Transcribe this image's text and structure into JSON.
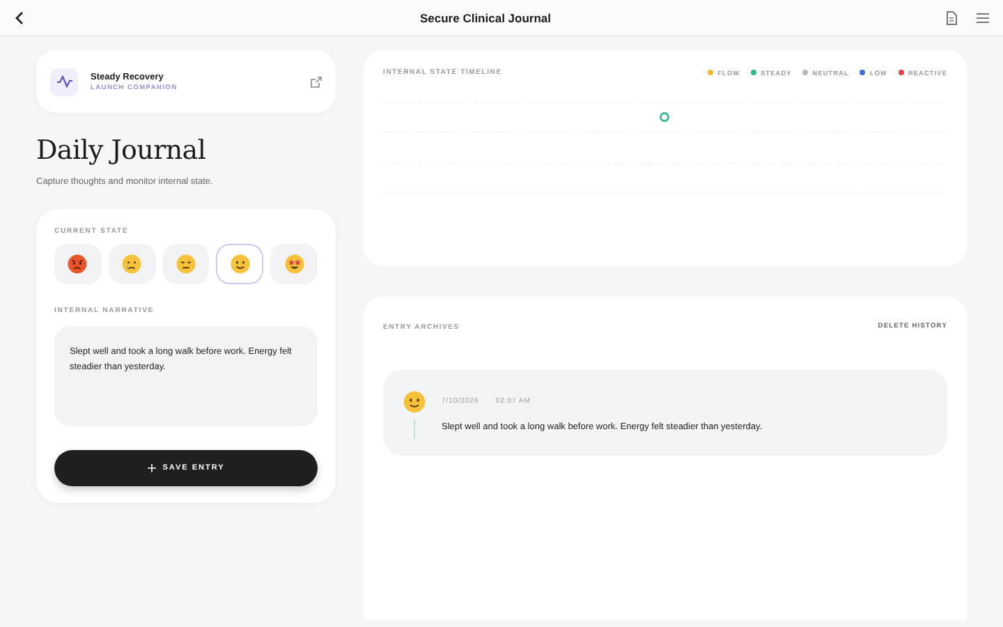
{
  "topbar": {
    "title": "Secure Clinical Journal"
  },
  "companion": {
    "title": "Steady Recovery",
    "subtitle": "LAUNCH COMPANION"
  },
  "heading": "Daily Journal",
  "subheading": "Capture thoughts and monitor internal state.",
  "form": {
    "state_label": "CURRENT STATE",
    "moods": [
      {
        "kind": "angry",
        "selected": false
      },
      {
        "kind": "crying",
        "selected": false
      },
      {
        "kind": "flat",
        "selected": false
      },
      {
        "kind": "smile",
        "selected": true
      },
      {
        "kind": "starstruck",
        "selected": false
      }
    ],
    "narrative_label": "INTERNAL NARRATIVE",
    "narrative": "Slept well and took a long walk before work. Energy felt steadier than yesterday.",
    "save": "SAVE ENTRY"
  },
  "timeline": {
    "title": "INTERNAL STATE TIMELINE",
    "legend": [
      {
        "label": "FLOW",
        "color": "#f5b82e"
      },
      {
        "label": "STEADY",
        "color": "#2ebd85"
      },
      {
        "label": "NEUTRAL",
        "color": "#b8b8c0"
      },
      {
        "label": "LOW",
        "color": "#3b6fd8"
      },
      {
        "label": "REACTIVE",
        "color": "#e0424b"
      }
    ]
  },
  "archive": {
    "title": "ENTRY ARCHIVES",
    "delete": "DELETE HISTORY",
    "entries": [
      {
        "kind": "smile",
        "date": "7/10/2026",
        "time": "02:07 AM",
        "text": "Slept well and took a long walk before work. Energy felt steadier than yesterday."
      }
    ]
  }
}
